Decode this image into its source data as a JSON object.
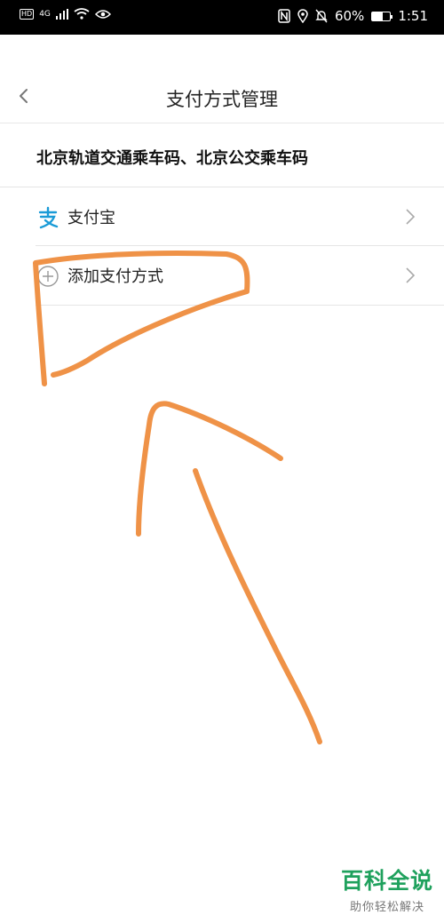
{
  "status_bar": {
    "hd": "HD",
    "network": "4G",
    "battery": "60%",
    "battery_level": 0.6,
    "time": "1:51"
  },
  "header": {
    "title": "支付方式管理"
  },
  "section": {
    "title": "北京轨道交通乘车码、北京公交乘车码"
  },
  "methods": [
    {
      "label": "支付宝",
      "icon": "alipay-icon"
    },
    {
      "label": "添加支付方式",
      "icon": "plus-circle-icon"
    }
  ],
  "annotation": {
    "color": "#ef9247"
  },
  "watermark": {
    "title": "百科全说",
    "subtitle": "助你轻松解决"
  }
}
